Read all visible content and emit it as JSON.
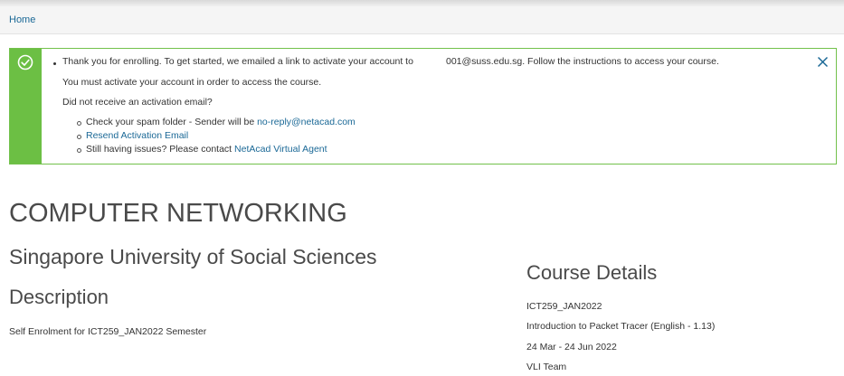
{
  "breadcrumb": {
    "home": "Home"
  },
  "alert": {
    "enroll_prefix": "Thank you for enrolling. To get started, we emailed a link to activate your account to",
    "enroll_email": "001@suss.edu.sg. Follow the instructions to access your course.",
    "activate_notice": "You must activate your account in order to access the course.",
    "not_received": "Did not receive an activation email?",
    "spam_prefix": "Check your spam folder - Sender will be",
    "sender_email": "no-reply@netacad.com",
    "resend_link": "Resend Activation Email",
    "issues_prefix": "Still having issues? Please contact",
    "agent_link": "NetAcad Virtual Agent",
    "accent_color": "#6cbf44"
  },
  "course": {
    "title": "COMPUTER NETWORKING",
    "university": "Singapore University of Social Sciences",
    "description_heading": "Description",
    "description_text": "Self Enrolment for ICT259_JAN2022 Semester"
  },
  "details": {
    "heading": "Course Details",
    "code": "ICT259_JAN2022",
    "name": "Introduction to Packet Tracer (English - 1.13)",
    "dates": "24 Mar - 24 Jun 2022",
    "team": "VLI Team"
  },
  "icons": {
    "status": "check-circle-icon",
    "dismiss": "close-icon"
  },
  "colors": {
    "link": "#1a6896",
    "heading": "#4a4a4a"
  }
}
